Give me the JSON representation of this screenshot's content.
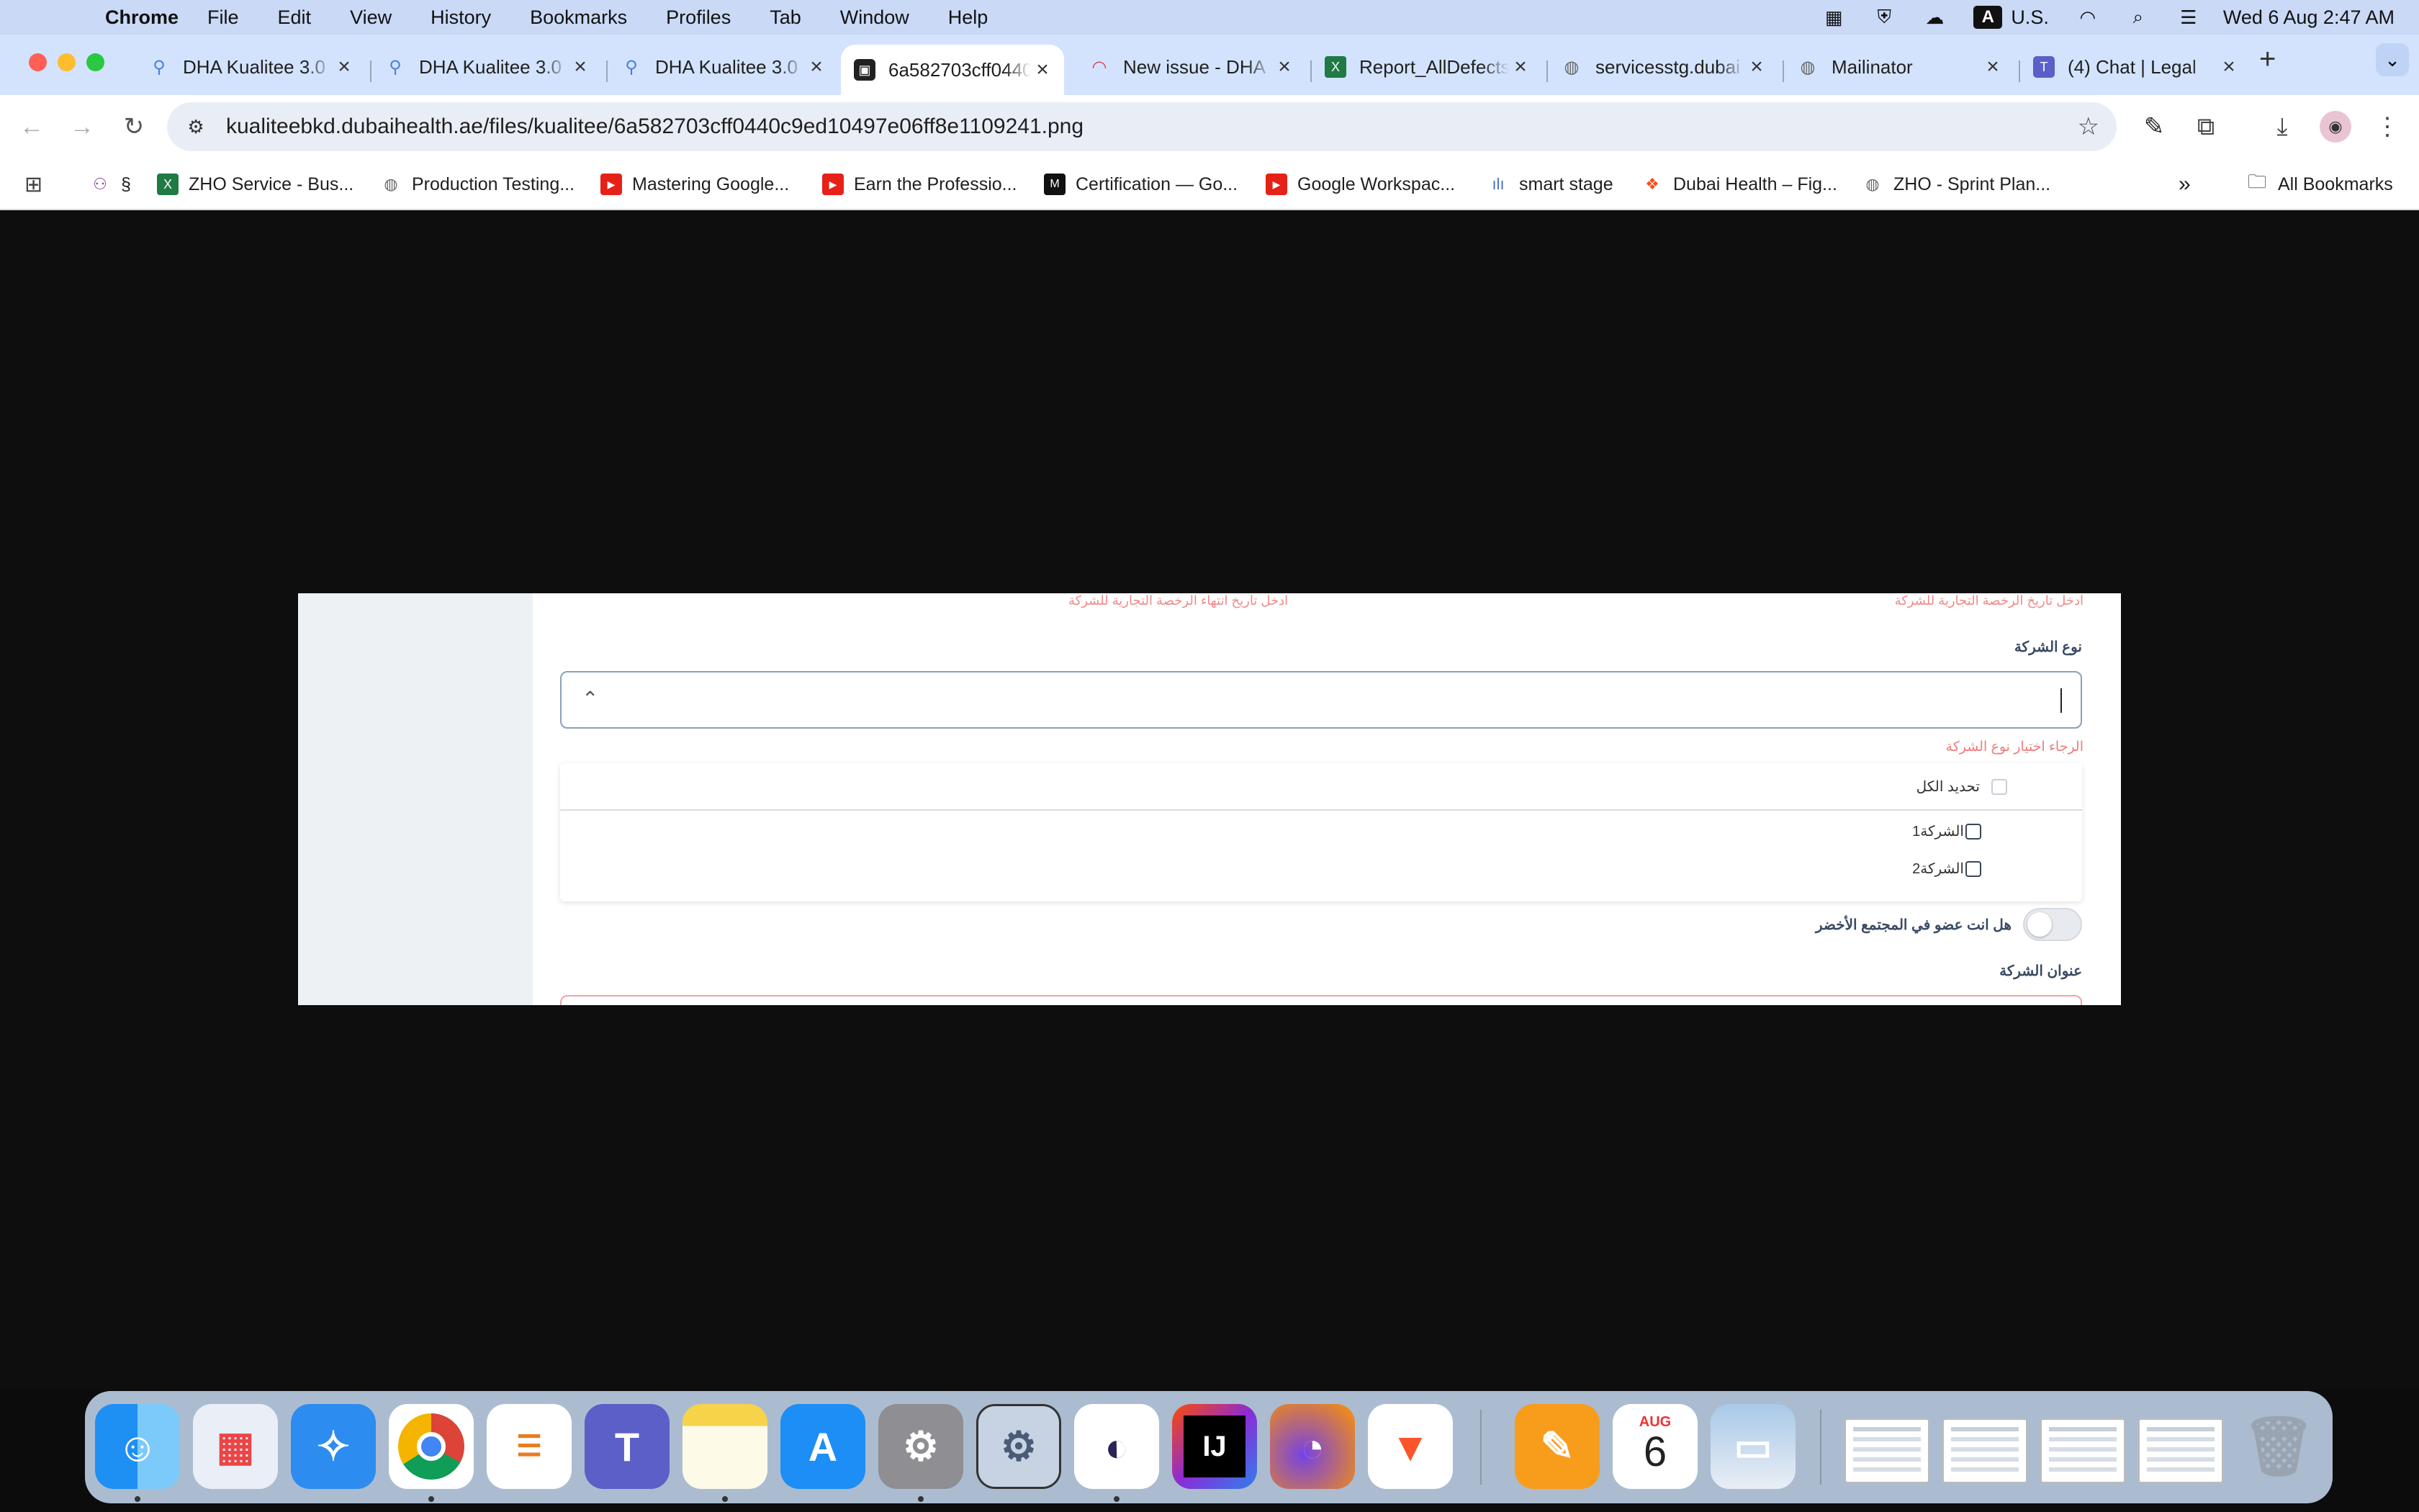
{
  "menubar": {
    "app_name": "Chrome",
    "menus": [
      "File",
      "Edit",
      "View",
      "History",
      "Bookmarks",
      "Profiles",
      "Tab",
      "Window",
      "Help"
    ],
    "input_source": "U.S.",
    "input_badge": "A",
    "datetime": "Wed 6 Aug  2:47 AM"
  },
  "tabs": [
    {
      "title": "DHA Kualitee 3.0",
      "icon": "kualitee-pin-icon"
    },
    {
      "title": "DHA Kualitee 3.0",
      "icon": "kualitee-pin-icon"
    },
    {
      "title": "DHA Kualitee 3.0",
      "icon": "kualitee-pin-icon"
    },
    {
      "title": "6a582703cff0440",
      "icon": "image-file-icon",
      "active": true
    },
    {
      "title": "New issue - DHA",
      "icon": "jira-icon"
    },
    {
      "title": "Report_AllDefects",
      "icon": "excel-icon"
    },
    {
      "title": "servicesstg.dubai",
      "icon": "globe-icon"
    },
    {
      "title": "Mailinator",
      "icon": "globe-icon"
    },
    {
      "title": "(4) Chat | Legal",
      "icon": "teams-icon"
    }
  ],
  "toolbar": {
    "url_host": "kualiteebkd.dubaihealth.ae",
    "url_path": "/files/kualitee/6a582703cff0440c9ed10497e06ff8e1109241.png"
  },
  "bookmarks": [
    {
      "label": "§",
      "icon": "people-icon"
    },
    {
      "label": "ZHO Service - Bus...",
      "icon": "excel-icon"
    },
    {
      "label": "Production Testing...",
      "icon": "globe-icon"
    },
    {
      "label": "Mastering Google...",
      "icon": "youtube-icon"
    },
    {
      "label": "Earn the Professio...",
      "icon": "youtube-icon"
    },
    {
      "label": "Certification — Go...",
      "icon": "medium-icon"
    },
    {
      "label": "Google Workspac...",
      "icon": "youtube-icon"
    },
    {
      "label": "smart stage",
      "icon": "chart-icon"
    },
    {
      "label": "Dubai Health – Fig...",
      "icon": "figma-icon"
    },
    {
      "label": "ZHO - Sprint Plan...",
      "icon": "globe-icon"
    }
  ],
  "all_bookmarks_label": "All Bookmarks",
  "form": {
    "err_license_date": "ادخل تاريخ الرخصة التجارية للشركة",
    "err_license_expiry": "ادخل تاريخ انتهاء الرخصة التجارية للشركة",
    "company_type_label": "نوع الشركة",
    "company_type_error": "الرجاء اختيار نوع الشركة",
    "select_all": "تحديد الكل",
    "options": [
      "الشركة1",
      "الشركة2"
    ],
    "green_member_label": "هل انت عضو في المجتمع الأخضر",
    "green_member_on": false,
    "company_address_label": "عنوان الشركة"
  },
  "dock": {
    "calendar_month": "AUG",
    "calendar_day": "6",
    "apps": [
      "Finder",
      "Launchpad",
      "Safari",
      "Chrome",
      "Reminders",
      "Teams",
      "Notes",
      "App Store",
      "System Settings",
      "Utility",
      "Eclipse",
      "IntelliJ IDEA",
      "Firefox",
      "Brave",
      "Pages",
      "Calendar",
      "Preview"
    ]
  }
}
